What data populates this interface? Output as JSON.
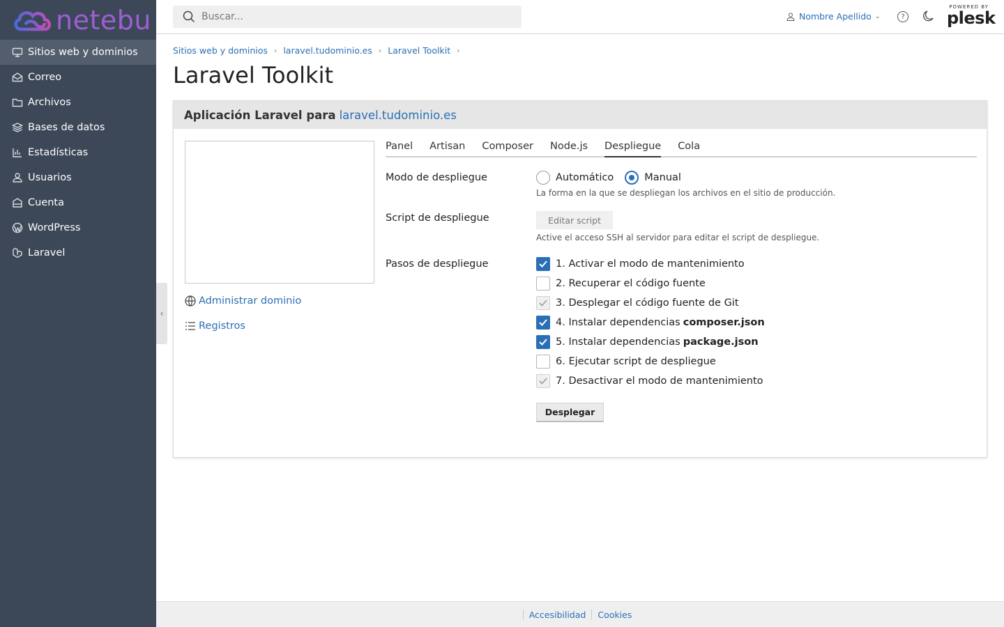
{
  "brand": {
    "name": "netebu"
  },
  "sidebar": {
    "items": [
      {
        "label": "Sitios web y dominios",
        "icon": "monitor-icon"
      },
      {
        "label": "Correo",
        "icon": "mail-icon"
      },
      {
        "label": "Archivos",
        "icon": "folder-icon"
      },
      {
        "label": "Bases de datos",
        "icon": "database-icon"
      },
      {
        "label": "Estadísticas",
        "icon": "chart-icon"
      },
      {
        "label": "Usuarios",
        "icon": "user-icon"
      },
      {
        "label": "Cuenta",
        "icon": "account-icon"
      },
      {
        "label": "WordPress",
        "icon": "wordpress-icon"
      },
      {
        "label": "Laravel",
        "icon": "laravel-icon"
      }
    ]
  },
  "header": {
    "search_placeholder": "Buscar...",
    "user_name": "Nombre Apellido",
    "powered_by": "POWERED BY",
    "plesk": "plesk"
  },
  "breadcrumb": [
    "Sitios web y dominios",
    "laravel.tudominio.es",
    "Laravel Toolkit"
  ],
  "page_title": "Laravel Toolkit",
  "card": {
    "title_prefix": "Aplicación Laravel para",
    "title_link": "laravel.tudominio.es",
    "links": {
      "manage_domain": "Administrar dominio",
      "logs": "Registros"
    },
    "tabs": [
      "Panel",
      "Artisan",
      "Composer",
      "Node.js",
      "Despliegue",
      "Cola"
    ],
    "active_tab": "Despliegue",
    "deploy_mode": {
      "label": "Modo de despliegue",
      "options": [
        "Automático",
        "Manual"
      ],
      "selected": "Manual",
      "hint": "La forma en la que se despliegan los archivos en el sitio de producción."
    },
    "deploy_script": {
      "label": "Script de despliegue",
      "button": "Editar script",
      "hint": "Active el acceso SSH al servidor para editar el script de despliegue."
    },
    "deploy_steps": {
      "label": "Pasos de despliegue",
      "steps": [
        {
          "text": "1. Activar el modo de mantenimiento",
          "bold": "",
          "state": "checked"
        },
        {
          "text": "2. Recuperar el código fuente",
          "bold": "",
          "state": "unchecked"
        },
        {
          "text": "3. Desplegar el código fuente de Git",
          "bold": "",
          "state": "disabled-checked"
        },
        {
          "text": "4. Instalar dependencias",
          "bold": "composer.json",
          "state": "checked"
        },
        {
          "text": "5. Instalar dependencias",
          "bold": "package.json",
          "state": "checked"
        },
        {
          "text": "6. Ejecutar script de despliegue",
          "bold": "",
          "state": "unchecked"
        },
        {
          "text": "7. Desactivar el modo de mantenimiento",
          "bold": "",
          "state": "disabled-checked"
        }
      ]
    },
    "deploy_button": "Desplegar"
  },
  "footer": {
    "links": [
      "Accesibilidad",
      "Cookies"
    ]
  },
  "colors": {
    "sidebar_bg": "#3c4858",
    "accent": "#2a6fb5",
    "brand": "#9d5ed2"
  }
}
